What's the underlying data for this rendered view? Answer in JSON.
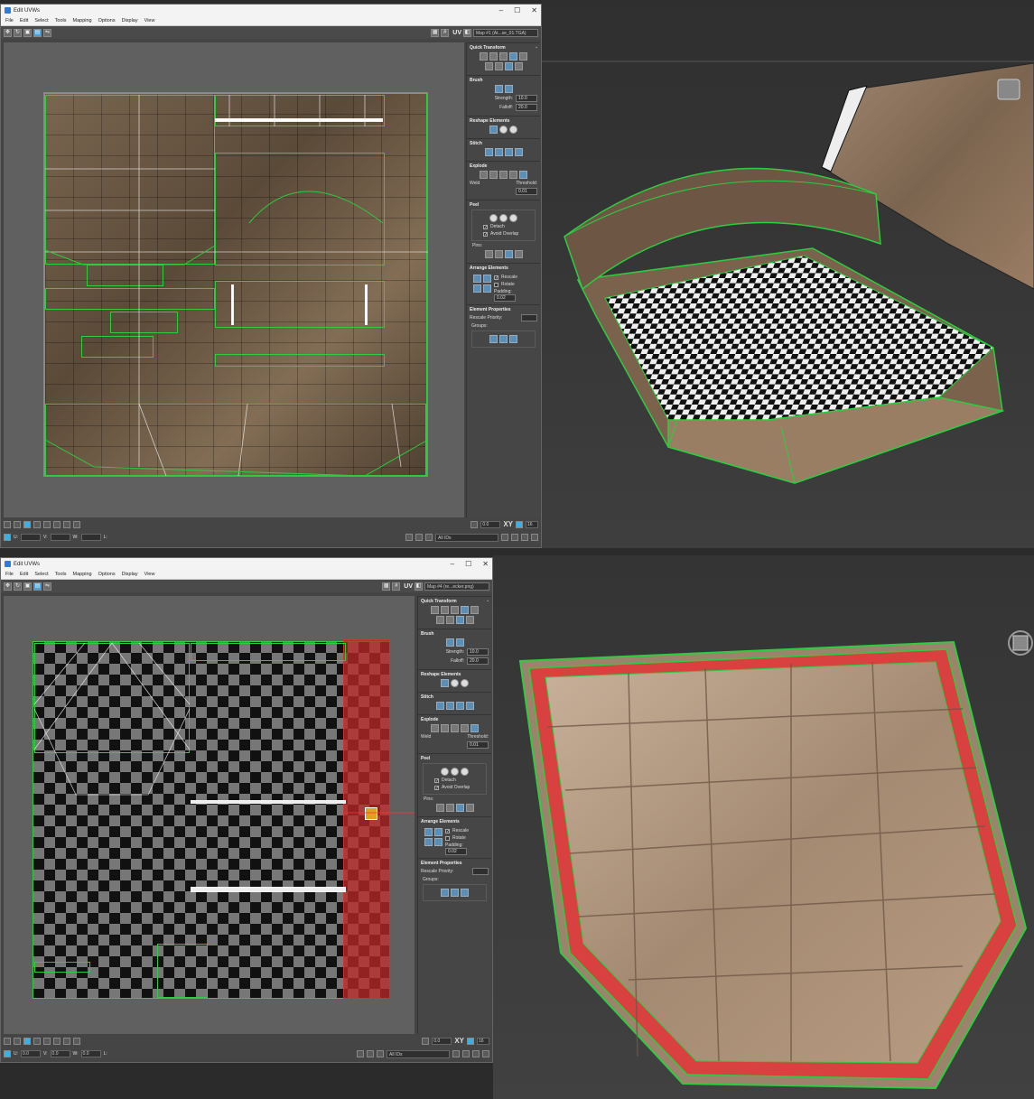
{
  "top_window": {
    "title": "Edit UVWs",
    "menu": [
      "File",
      "Edit",
      "Select",
      "Tools",
      "Mapping",
      "Options",
      "Display",
      "View"
    ],
    "uv_label": "UV",
    "map_select": "Map #1 (At...se_01.TGA)",
    "window_controls": [
      "–",
      "☐",
      "✕"
    ]
  },
  "bottom_window": {
    "title": "Edit UVWs",
    "menu": [
      "File",
      "Edit",
      "Select",
      "Tools",
      "Mapping",
      "Options",
      "Display",
      "View"
    ],
    "uv_label": "UV",
    "map_select": "Map #4 (re...ecker.png)",
    "window_controls": [
      "–",
      "☐",
      "✕"
    ]
  },
  "panel": {
    "quick_transform": "Quick Transform",
    "brush": "Brush",
    "strength_label": "Strength:",
    "strength_value": "10.0",
    "falloff_label": "Falloff:",
    "falloff_value": "20.0",
    "reshape": "Reshape Elements",
    "stitch": "Stitch",
    "explode": "Explode",
    "weld": "Weld",
    "threshold_label": "Threshold:",
    "threshold_value": "0.01",
    "peel": "Peel",
    "detach": "Detach",
    "avoid_overlap": "Avoid Overlap",
    "pins": "Pins:",
    "arrange": "Arrange Elements",
    "rescale": "Rescale",
    "rotate": "Rotate",
    "padding_label": "Padding:",
    "padding_value": "0.02",
    "element_props": "Element Properties",
    "rescale_priority": "Rescale Priority:",
    "groups": "Groups:"
  },
  "status": {
    "xy": "XY",
    "value_top": "0.0",
    "u_label": "U:",
    "v_label": "V:",
    "w_label": "W:",
    "l_label": "L:",
    "grid_value": "16",
    "all_ids": "All IDs",
    "bottom_u": "0.0",
    "bottom_v": "0.0",
    "bottom_w": "0.0"
  }
}
